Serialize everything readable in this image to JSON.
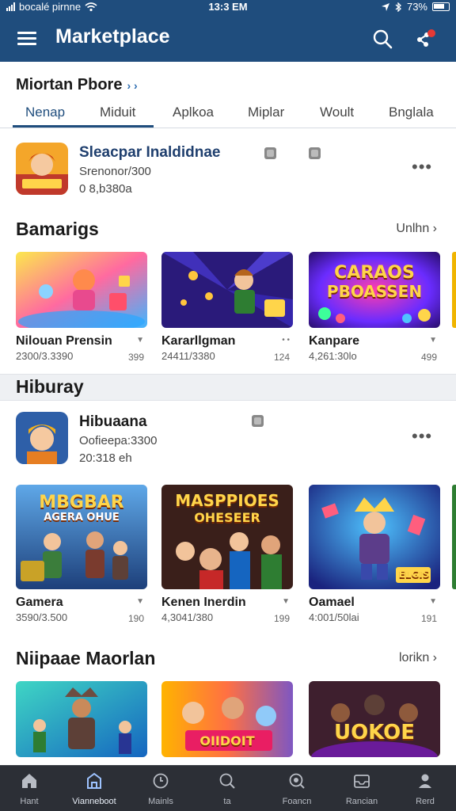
{
  "status_bar": {
    "carrier": "bocalé pirnne",
    "time": "13:3 EM",
    "battery": "73%"
  },
  "app_bar": {
    "title": "Marketplace"
  },
  "store": {
    "heading": "Miortan Pbore",
    "heading_chevron": "› ›"
  },
  "tabs": [
    "Nenap",
    "Miduit",
    "Aplkoa",
    "Miplar",
    "Woult",
    "Bnglala"
  ],
  "featured_top": {
    "name": "Sleacpar Inaldidnae",
    "meta1": "Srenonor/300",
    "meta2": "0 8,b380a"
  },
  "section_bamarigs": {
    "title": "Bamarigs",
    "link": "Unlhn ›"
  },
  "row1": [
    {
      "name": "Nilouan Prensin",
      "sub": "2300/3.3390",
      "num": "399"
    },
    {
      "name": "Kararllgman",
      "sub": "24411/3380",
      "num": "124"
    },
    {
      "name": "Kanpare",
      "sub": "4,261:30lo",
      "num": "499",
      "art_line1": "CARAOS",
      "art_line2": "PBOASSEN"
    }
  ],
  "section_hiburay": {
    "title": "Hiburay"
  },
  "featured_mid": {
    "name": "Hibuaana",
    "meta1": "Oofieepa:3300",
    "meta2": "20:318 eh"
  },
  "row2": [
    {
      "name": "Gamera",
      "sub": "3590/3.500",
      "num": "190",
      "art_line1": "MBGBAR",
      "art_line2": "AGERA OHUE"
    },
    {
      "name": "Kenen Inerdin",
      "sub": "4,3041/380",
      "num": "199",
      "art_line1": "MASPPIOES",
      "art_line2": "OHESEER"
    },
    {
      "name": "Oamael",
      "sub": "4:001/50lai",
      "num": "191",
      "art_line1": "",
      "art_line2": "ELGIS"
    }
  ],
  "section_niipaae": {
    "title": "Niipaae Maorlan",
    "link": "lorikn ›"
  },
  "row3": [
    {
      "art_line1": "",
      "art_line2": ""
    },
    {
      "art_line1": "OIIDOIT",
      "art_line2": ""
    },
    {
      "art_line1": "UOKOE",
      "art_line2": ""
    }
  ],
  "bottom_nav": [
    {
      "label": "Hant",
      "icon": "home-icon"
    },
    {
      "label": "Vianneboot",
      "icon": "store-icon",
      "active": true
    },
    {
      "label": "Mainls",
      "icon": "clock-icon"
    },
    {
      "label": "ta",
      "icon": "search-icon"
    },
    {
      "label": "Foancn",
      "icon": "search-alt-icon"
    },
    {
      "label": "Rancian",
      "icon": "inbox-icon"
    },
    {
      "label": "Rerd",
      "icon": "user-icon"
    }
  ],
  "colors": {
    "primary": "#1f4d7d",
    "nav_bg": "#2c2f36",
    "notif_dot": "#e53935"
  }
}
